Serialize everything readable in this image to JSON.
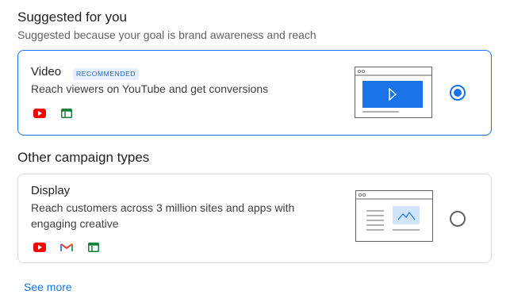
{
  "suggested": {
    "heading": "Suggested for you",
    "subtitle": "Suggested because your goal is brand awareness and reach"
  },
  "video_card": {
    "title": "Video",
    "badge": "RECOMMENDED",
    "description": "Reach viewers on YouTube and get conversions",
    "selected": true,
    "icons": [
      "youtube-icon",
      "google-display-icon"
    ]
  },
  "other": {
    "heading": "Other campaign types"
  },
  "display_card": {
    "title": "Display",
    "description_line1": "Reach customers across 3 million sites and apps with",
    "description_line2": "engaging creative",
    "selected": false,
    "icons": [
      "youtube-icon",
      "gmail-icon",
      "google-display-icon"
    ]
  },
  "see_more_label": "See more",
  "colors": {
    "accent": "#1a73e8",
    "youtube_red": "#ff0000",
    "display_green": "#188038"
  }
}
